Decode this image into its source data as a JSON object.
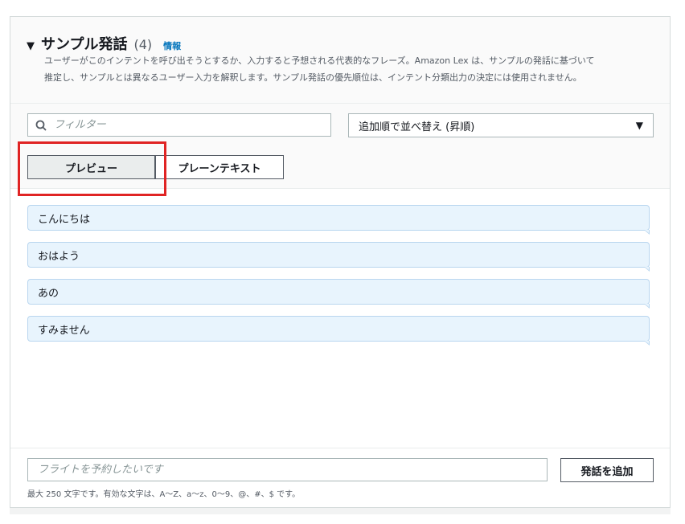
{
  "header": {
    "title": "サンプル発話",
    "count": "(4)",
    "info_link": "情報",
    "description_line1": "ユーザーがこのインテントを呼び出そうとするか、入力すると予想される代表的なフレーズ。Amazon Lex は、サンプルの発話に基づいて",
    "description_line2": "推定し、サンプルとは異なるユーザー入力を解釈します。サンプル発話の優先順位は、インテント分類出力の決定には使用されません。"
  },
  "toolbar": {
    "filter_placeholder": "フィルター",
    "sort_label": "追加順で並べ替え (昇順)",
    "tabs": [
      "プレビュー",
      "プレーンテキスト"
    ]
  },
  "utterances": [
    "こんにちは",
    "おはよう",
    "あの",
    "すみません"
  ],
  "footer": {
    "input_placeholder": "フライトを予約したいです",
    "add_button": "発話を追加",
    "constraint": "最大 250 文字です。有効な文字は、A〜Z、a〜z、0〜9、@、#、$ です。"
  },
  "colors": {
    "accent_link": "#0073bb",
    "bubble_bg": "#e8f4fd",
    "highlight": "#e02424"
  },
  "icons": {
    "caret": "caret-down-icon",
    "filter": "search-icon",
    "sort": "dropdown-arrow-icon"
  }
}
